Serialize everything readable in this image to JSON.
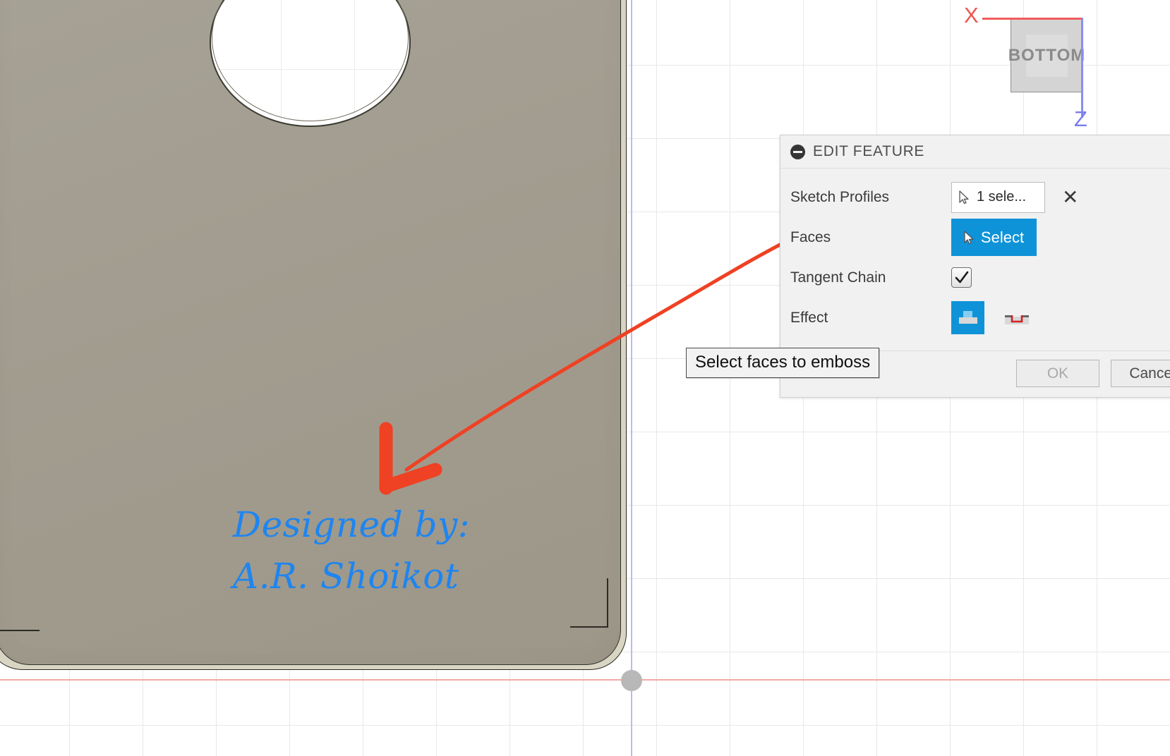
{
  "app": {
    "viewport_background": "#ffffff",
    "grid_color": "#e8e8e8"
  },
  "viewcube": {
    "face_label": "BOTTOM",
    "axis_x_label": "X",
    "axis_z_label": "Z",
    "axis_x_color": "#f0554f",
    "axis_z_color": "#7a7cef"
  },
  "model": {
    "body_color": "#a29d90",
    "edge_color": "#33332b",
    "engraved_text_color": "#1e85f0",
    "engraved_line_1": "Designed by:",
    "engraved_line_2": "A.R. Shoikot"
  },
  "annotation": {
    "color": "#ef4123",
    "type": "hand-drawn-arrow",
    "points_from": "Sketch Profiles field",
    "points_to": "engraved text on model face"
  },
  "dialog": {
    "title": "EDIT FEATURE",
    "collapse_icon": "minus-circle-icon",
    "rows": [
      {
        "label": "Sketch Profiles",
        "control": "selection-field",
        "value": "1 sele...",
        "icon": "cursor-arrow-icon",
        "clear_label": "✕"
      },
      {
        "label": "Faces",
        "control": "select-button",
        "value": "Select",
        "icon": "cursor-arrow-icon",
        "accent": "#0f93d8"
      },
      {
        "label": "Tangent Chain",
        "control": "checkbox",
        "checked": true
      },
      {
        "label": "Effect",
        "control": "toggle-group",
        "options": [
          {
            "name": "emboss-icon",
            "active": true
          },
          {
            "name": "engrave-icon",
            "active": false
          }
        ]
      }
    ],
    "buttons": {
      "ok_label": "OK",
      "ok_enabled": false,
      "cancel_label": "Cancel",
      "cancel_enabled": true
    }
  },
  "tooltip": {
    "text": "Select faces to emboss"
  }
}
